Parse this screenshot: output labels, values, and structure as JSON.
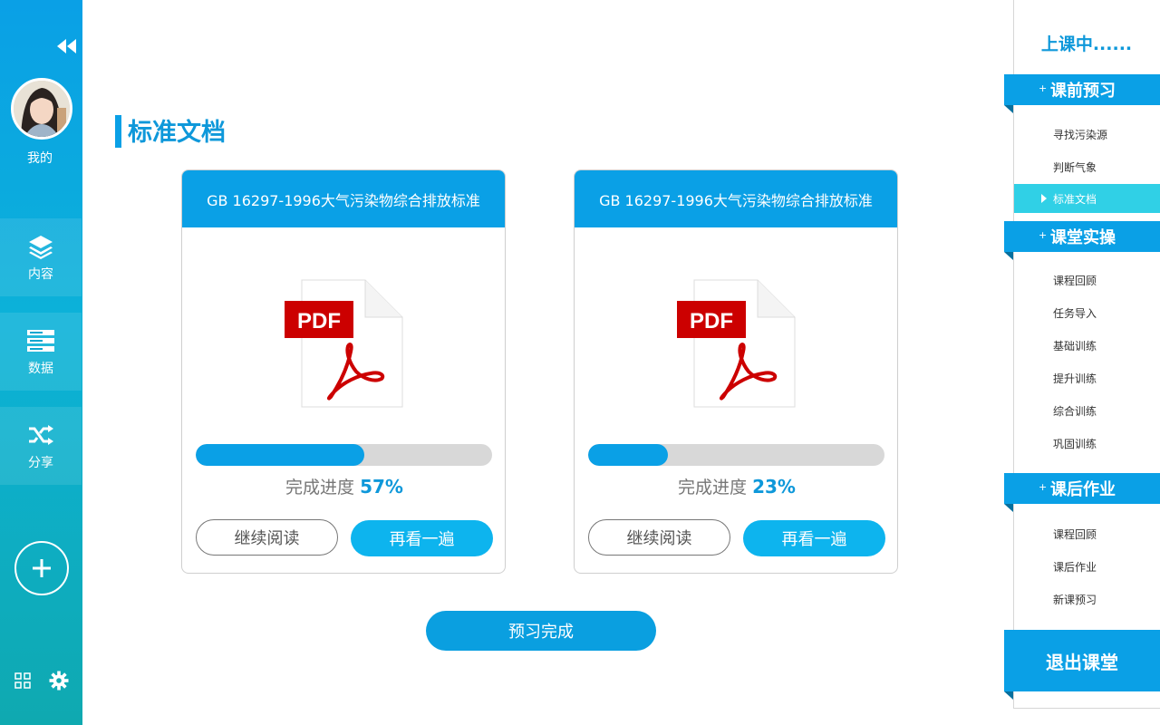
{
  "sidebar": {
    "me_label": "我的",
    "nav": [
      {
        "label": "内容",
        "icon": "layers-icon"
      },
      {
        "label": "数据",
        "icon": "database-icon"
      },
      {
        "label": "分享",
        "icon": "shuffle-icon"
      }
    ],
    "add_icon": "plus-circle-icon",
    "bottom_icons": [
      "grid-icon",
      "gear-icon"
    ]
  },
  "main": {
    "title": "标准文档",
    "cards": [
      {
        "title": "GB 16297-1996大气污染物综合排放标准",
        "icon": "pdf-file-icon",
        "progress_label": "完成进度",
        "progress_value": "57%",
        "progress_fraction": 0.57,
        "continue_label": "继续阅读",
        "reread_label": "再看一遍"
      },
      {
        "title": "GB 16297-1996大气污染物综合排放标准",
        "icon": "pdf-file-icon",
        "progress_label": "完成进度",
        "progress_value": "23%",
        "progress_fraction": 0.23,
        "continue_label": "继续阅读",
        "reread_label": "再看一遍"
      }
    ],
    "done_label": "预习完成"
  },
  "right_panel": {
    "status": "上课中......",
    "sections": [
      {
        "title": "课前预习",
        "items": [
          "寻找污染源",
          "判断气象",
          "标准文档"
        ],
        "active_index": 2
      },
      {
        "title": "课堂实操",
        "items": [
          "课程回顾",
          "任务导入",
          "基础训练",
          "提升训练",
          "综合训练",
          "巩固训练"
        ]
      },
      {
        "title": "课后作业",
        "items": [
          "课程回顾",
          "课后作业",
          "新课预习"
        ]
      }
    ],
    "exit_label": "退出课堂"
  },
  "colors": {
    "accent": "#0aa0e6",
    "active_item": "#30d0e6",
    "button": "#0db4ee",
    "pdf_red": "#cc0000"
  }
}
